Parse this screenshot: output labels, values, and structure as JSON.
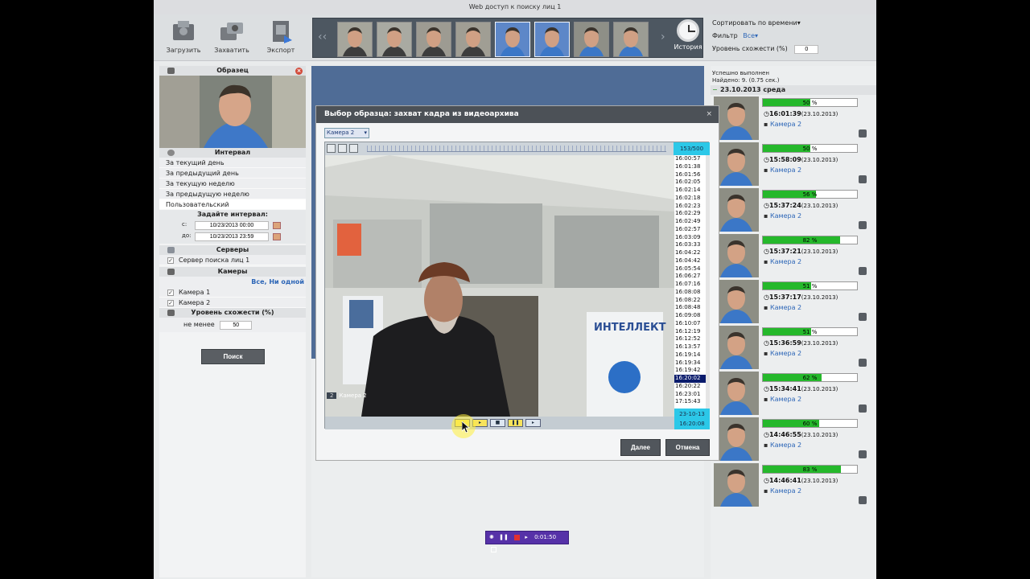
{
  "window": {
    "title": "Web доступ к поиску лиц 1"
  },
  "toolbar": {
    "upload_label": "Загрузить",
    "capture_label": "Захватить",
    "export_label": "Экспорт",
    "history_label": "История"
  },
  "sort_panel": {
    "sort_label": "Сортировать по времени▾",
    "filter_label": "Фильтр",
    "filter_value": "Все▾",
    "similarity_label": "Уровень схожести (%)",
    "similarity_value": "0"
  },
  "left_panel": {
    "sample_title": "Образец",
    "interval_title": "Интервал",
    "interval_options": [
      "За текущий день",
      "За предыдущий день",
      "За текущую неделю",
      "За предыдущую неделю"
    ],
    "custom_label": "Пользовательский",
    "set_interval_label": "Задайте интервал:",
    "from_label": "с:",
    "from_value": "10/23/2013 00:00",
    "to_label": "до:",
    "to_value": "10/23/2013 23:59",
    "servers_title": "Серверы",
    "server_name": "Сервер поиска лиц 1",
    "cameras_title": "Камеры",
    "cameras_links": "Все, Ни одной",
    "cameras": [
      "Камера 1",
      "Камера 2"
    ],
    "similarity_title": "Уровень схожести (%)",
    "min_label": "не менее",
    "min_value": "50",
    "search_label": "Поиск"
  },
  "dialog": {
    "title": "Выбор образца: захват кадра из видеоархива",
    "camera_selected": "Камера 2",
    "counter": "153/500",
    "times": [
      "16:00:57",
      "16:01:38",
      "16:01:56",
      "16:02:05",
      "16:02:14",
      "16:02:18",
      "16:02:23",
      "16:02:29",
      "16:02:49",
      "16:02:57",
      "16:03:09",
      "16:03:33",
      "16:04:22",
      "16:04:42",
      "16:05:54",
      "16:06:27",
      "16:07:16",
      "16:08:08",
      "16:08:22",
      "16:08:48",
      "16:09:08",
      "16:10:07",
      "16:12:19",
      "16:12:52",
      "16:13:57",
      "16:19:14",
      "16:19:34",
      "16:19:42",
      "16:20:02",
      "16:20:22",
      "16:23:01",
      "17:15:43"
    ],
    "selected_time_index": 28,
    "date_line": "23-10-13",
    "time_line": "16:20:08",
    "camera_number": "2",
    "camera_caption": "Камера 2",
    "next_label": "Далее",
    "cancel_label": "Отмена",
    "video_sign": "ИНТЕЛЛЕКТ"
  },
  "results": {
    "status": "Успешно выполнен",
    "found": "Найдено: 9. (0.75 сек.)",
    "date_header": "23.10.2013 среда",
    "items": [
      {
        "percent": 50,
        "percent_label": "50 %",
        "time": "16:01:39",
        "date": "(23.10.2013)",
        "camera": "Камера 2"
      },
      {
        "percent": 50,
        "percent_label": "50 %",
        "time": "15:58:09",
        "date": "(23.10.2013)",
        "camera": "Камера 2"
      },
      {
        "percent": 56,
        "percent_label": "56 %",
        "time": "15:37:24",
        "date": "(23.10.2013)",
        "camera": "Камера 2"
      },
      {
        "percent": 82,
        "percent_label": "82 %",
        "time": "15:37:21",
        "date": "(23.10.2013)",
        "camera": "Камера 2"
      },
      {
        "percent": 51,
        "percent_label": "51 %",
        "time": "15:37:17",
        "date": "(23.10.2013)",
        "camera": "Камера 2"
      },
      {
        "percent": 51,
        "percent_label": "51 %",
        "time": "15:36:59",
        "date": "(23.10.2013)",
        "camera": "Камера 2"
      },
      {
        "percent": 62,
        "percent_label": "62 %",
        "time": "15:34:41",
        "date": "(23.10.2013)",
        "camera": "Камера 2"
      },
      {
        "percent": 60,
        "percent_label": "60 %",
        "time": "14:46:55",
        "date": "(23.10.2013)",
        "camera": "Камера 2"
      },
      {
        "percent": 83,
        "percent_label": "83 %",
        "time": "14:46:41",
        "date": "(23.10.2013)",
        "camera": "Камера 2"
      }
    ]
  },
  "recorder": {
    "time": "0:01:50"
  },
  "colors": {
    "accent": "#25b82b",
    "selection": "#0a1b6c",
    "cyan": "#2cc8e8"
  }
}
